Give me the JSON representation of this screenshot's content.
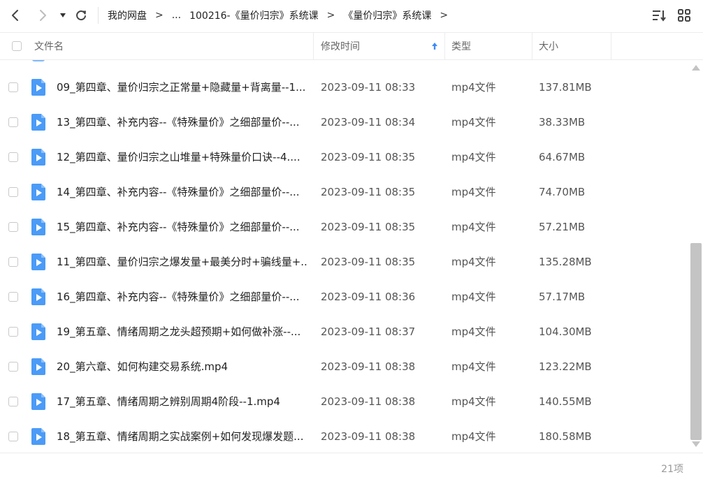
{
  "toolbar": {
    "breadcrumbs": [
      "我的网盘",
      "...",
      "100216-《量价归宗》系统课",
      "《量价归宗》系统课"
    ]
  },
  "columns": {
    "name": "文件名",
    "modified": "修改时间",
    "type": "类型",
    "size": "大小"
  },
  "files": [
    {
      "name": "09_第四章、量价归宗之正常量+隐藏量+背离量--1...",
      "modified": "2023-09-11 08:33",
      "type": "mp4文件",
      "size": "137.81MB"
    },
    {
      "name": "13_第四章、补充内容--《特殊量价》之细部量价--...",
      "modified": "2023-09-11 08:34",
      "type": "mp4文件",
      "size": "38.33MB"
    },
    {
      "name": "12_第四章、量价归宗之山堆量+特殊量价口诀--4....",
      "modified": "2023-09-11 08:35",
      "type": "mp4文件",
      "size": "64.67MB"
    },
    {
      "name": "14_第四章、补充内容--《特殊量价》之细部量价--...",
      "modified": "2023-09-11 08:35",
      "type": "mp4文件",
      "size": "74.70MB"
    },
    {
      "name": "15_第四章、补充内容--《特殊量价》之细部量价--...",
      "modified": "2023-09-11 08:35",
      "type": "mp4文件",
      "size": "57.21MB"
    },
    {
      "name": "11_第四章、量价归宗之爆发量+最美分时+骗线量+...",
      "modified": "2023-09-11 08:35",
      "type": "mp4文件",
      "size": "135.28MB"
    },
    {
      "name": "16_第四章、补充内容--《特殊量价》之细部量价--...",
      "modified": "2023-09-11 08:36",
      "type": "mp4文件",
      "size": "57.17MB"
    },
    {
      "name": "19_第五章、情绪周期之龙头超预期+如何做补涨--...",
      "modified": "2023-09-11 08:37",
      "type": "mp4文件",
      "size": "104.30MB"
    },
    {
      "name": "20_第六章、如何构建交易系统.mp4",
      "modified": "2023-09-11 08:38",
      "type": "mp4文件",
      "size": "123.22MB"
    },
    {
      "name": "17_第五章、情绪周期之辨别周期4阶段--1.mp4",
      "modified": "2023-09-11 08:38",
      "type": "mp4文件",
      "size": "140.55MB"
    },
    {
      "name": "18_第五章、情绪周期之实战案例+如何发现爆发题...",
      "modified": "2023-09-11 08:38",
      "type": "mp4文件",
      "size": "180.58MB"
    }
  ],
  "footer": {
    "count": "21项"
  },
  "colors": {
    "accent": "#3d8bf6",
    "icon_blue": "#4b9bf7"
  }
}
